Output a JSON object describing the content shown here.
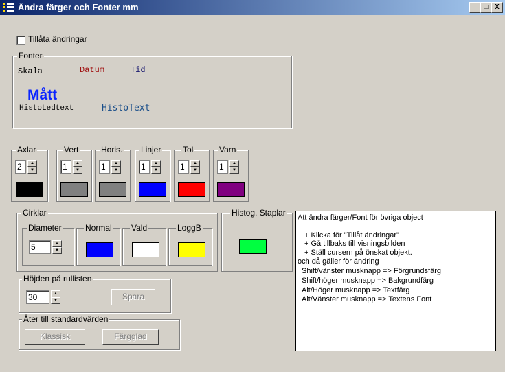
{
  "window": {
    "title": "Ändra färger och Fonter mm",
    "buttons": {
      "minimize": "_",
      "maximize": "□",
      "close": "X"
    }
  },
  "allow_changes": {
    "label": "Tillåta ändringar",
    "checked": false
  },
  "fonts": {
    "group_title": "Fonter",
    "samples": {
      "skala": "Skala",
      "datum": "Datum",
      "tid": "Tid",
      "matt": "Mått",
      "histoledtext": "HistoLedtext",
      "histotext": "HistoText"
    },
    "colors": {
      "datum": "#a01010",
      "tid": "#1a1a70",
      "matt": "#0a24ff",
      "histotext": "#1b4f8a"
    }
  },
  "axes": [
    {
      "label": "Axlar",
      "value": "2",
      "color": "#000000"
    },
    {
      "label": "Vert",
      "value": "1",
      "color": "#808080"
    },
    {
      "label": "Horis.",
      "value": "1",
      "color": "#808080"
    },
    {
      "label": "Linjer",
      "value": "1",
      "color": "#0000ff"
    },
    {
      "label": "Tol",
      "value": "1",
      "color": "#ff0000"
    },
    {
      "label": "Varn",
      "value": "1",
      "color": "#800080"
    }
  ],
  "circles": {
    "group_title": "Cirklar",
    "diameter": {
      "label": "Diameter",
      "value": "5"
    },
    "normal": {
      "label": "Normal",
      "color": "#0000ff"
    },
    "vald": {
      "label": "Vald",
      "color": "#ffffff"
    },
    "loggb": {
      "label": "LoggB",
      "color": "#ffff00"
    }
  },
  "histog": {
    "label": "Histog. Staplar",
    "color": "#00ff40"
  },
  "scroll_height": {
    "label": "Höjden på rullisten",
    "value": "30",
    "save_label": "Spara"
  },
  "defaults": {
    "label": "Åter till standardvärden",
    "classic_label": "Klassisk",
    "colorful_label": "Färgglad"
  },
  "info": {
    "lines": [
      "Att ändra färger/Font för övriga object",
      "+ Klicka för  \"Tillåt ändringar\"",
      "+ Gå tillbaks till visningsbilden",
      "+ Ställ cursern på önskat objekt.",
      "och då gäller för ändring",
      "Shift/vänster musknapp  => Förgrundsfärg",
      "Shift/höger    musknapp => Bakgrundfärg",
      "Alt/Höger  musknapp => Textfärg",
      "Alt/Vänster musknapp => Textens Font"
    ]
  }
}
